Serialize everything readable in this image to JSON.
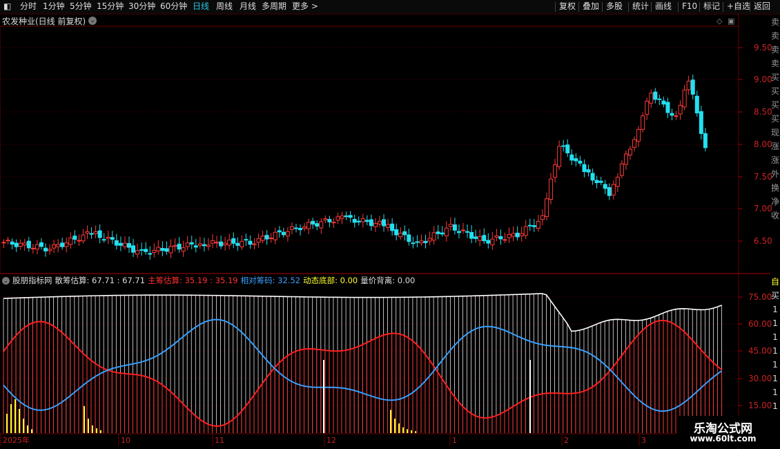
{
  "toolbar": {
    "left_items": [
      "分时",
      "1分钟",
      "5分钟",
      "15分钟",
      "30分钟",
      "60分钟",
      "日线",
      "周线",
      "月线",
      "多周期",
      "更多 >"
    ],
    "active_item": "日线",
    "right_items": [
      "复权",
      "叠加",
      "多股",
      "统计",
      "画线",
      "F10",
      "标记",
      "+自选",
      "返回"
    ]
  },
  "main_chart": {
    "title": "农发种业(日线 前复权)",
    "y_ticks": [
      "9.50",
      "9.00",
      "8.50",
      "8.00",
      "7.50",
      "7.00",
      "6.50"
    ],
    "colors": {
      "up": "#ff3a3a",
      "down": "#22e0f0",
      "grid": "#5a0000"
    }
  },
  "indicator": {
    "legend": [
      {
        "text": "股朋指标网",
        "color": "#dddddd"
      },
      {
        "text": "散筹估算: 67.71 : 67.71",
        "color": "#dddddd"
      },
      {
        "text": "主筹估算: 35.19 : 35.19",
        "color": "#ff3030"
      },
      {
        "text": "相对筹码: 32.52",
        "color": "#3aa0ff"
      },
      {
        "text": "动态底部: 0.00",
        "color": "#ffff30"
      },
      {
        "text": "量价背离: 0.00",
        "color": "#dddddd"
      }
    ],
    "y_ticks": [
      "75.00",
      "60.00",
      "45.00",
      "30.00",
      "15.00"
    ]
  },
  "x_axis": {
    "labels": [
      "2025年",
      "10",
      "11",
      "12",
      "1",
      "2",
      "3"
    ]
  },
  "right_strip_chars": [
    "卖",
    "卖",
    "卖",
    "卖",
    "买",
    "买",
    "买",
    "买",
    "现",
    "涨",
    "涨",
    "外",
    "换",
    "净",
    "收"
  ],
  "right_strip_chars_2": [
    "自",
    "买",
    "1",
    "1",
    "1",
    "1",
    "1",
    "1",
    "1",
    "1"
  ],
  "watermark": {
    "title": "乐淘公式网",
    "url": "www.60lt.com"
  }
}
